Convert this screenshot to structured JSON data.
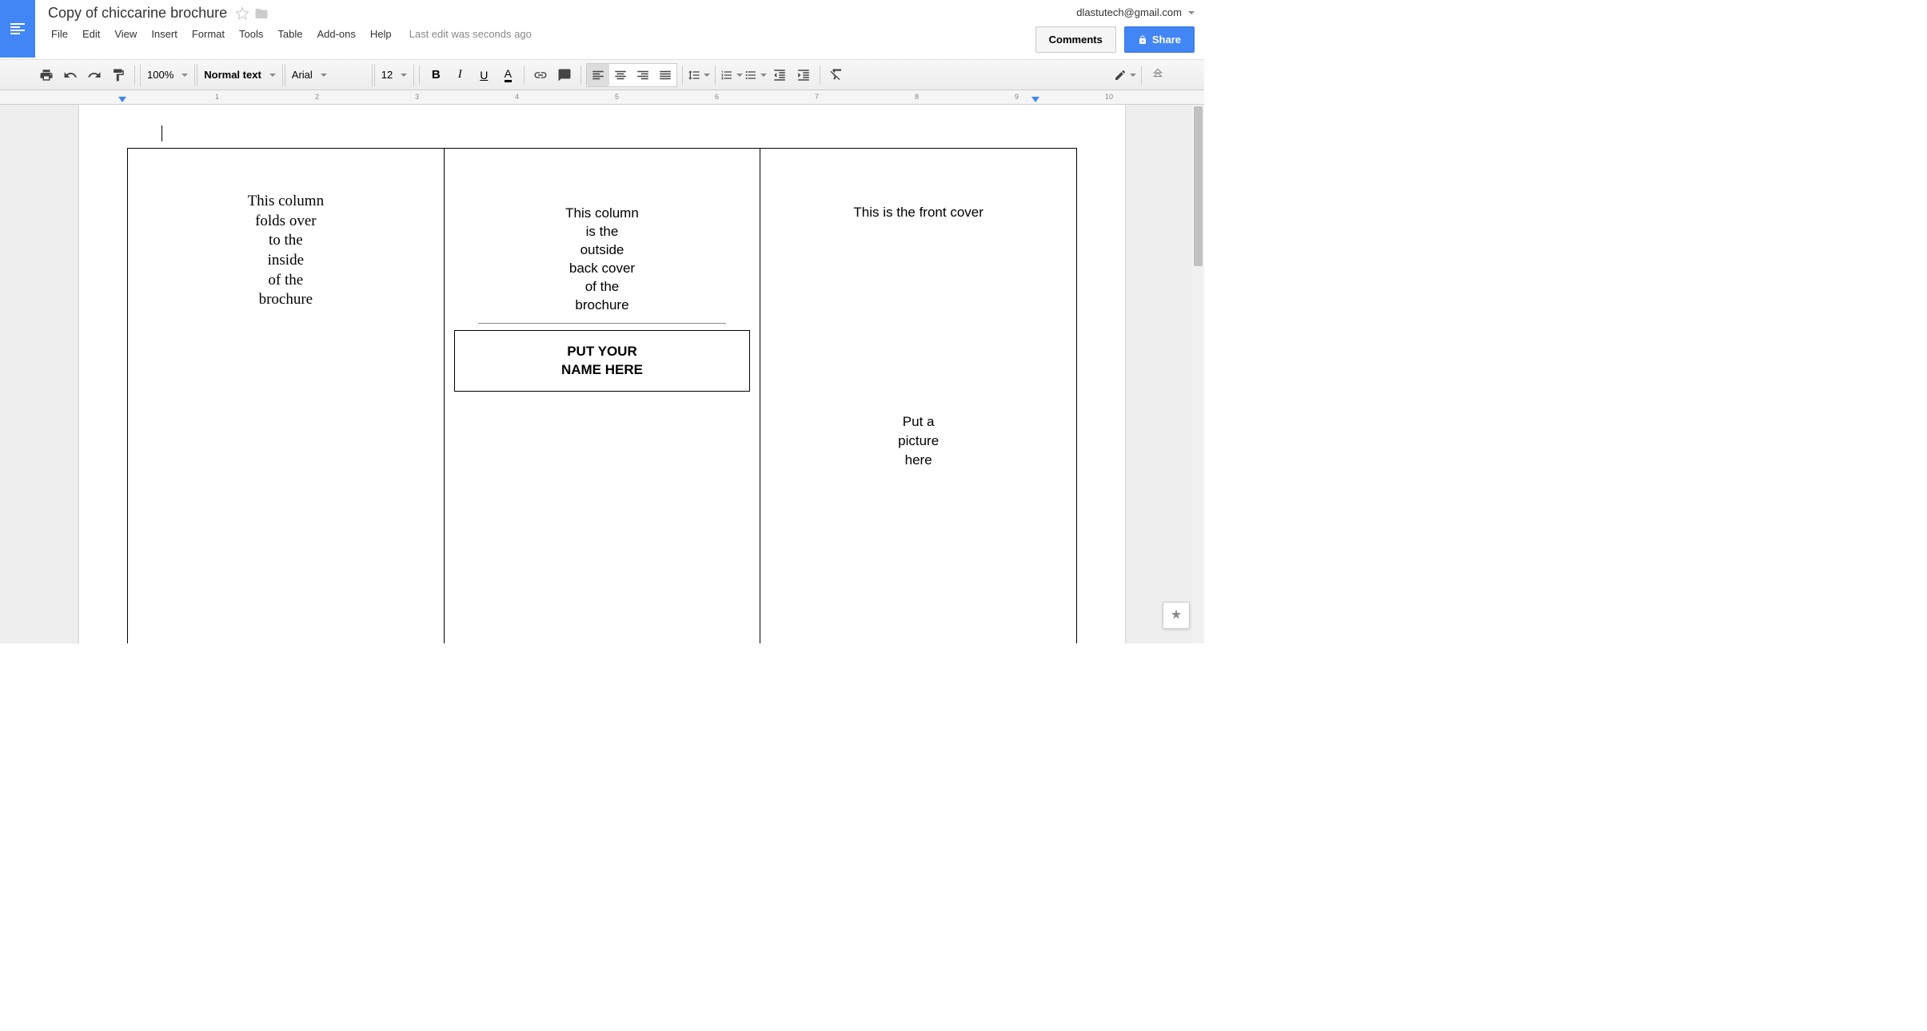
{
  "header": {
    "doc_title": "Copy of chiccarine brochure",
    "user_email": "dlastutech@gmail.com",
    "comments_label": "Comments",
    "share_label": "Share",
    "last_edit": "Last edit was seconds ago"
  },
  "menu": {
    "file": "File",
    "edit": "Edit",
    "view": "View",
    "insert": "Insert",
    "format": "Format",
    "tools": "Tools",
    "table": "Table",
    "addons": "Add-ons",
    "help": "Help"
  },
  "toolbar": {
    "zoom": "100%",
    "style": "Normal text",
    "font": "Arial",
    "size": "12"
  },
  "ruler": {
    "ticks": [
      "1",
      "2",
      "3",
      "4",
      "5",
      "6",
      "7",
      "8",
      "9",
      "10"
    ]
  },
  "document": {
    "col1": {
      "l1": "This column",
      "l2": "folds over",
      "l3": "to the",
      "l4": "inside",
      "l5": "of the",
      "l6": "brochure"
    },
    "col2": {
      "l1": "This column",
      "l2": "is the",
      "l3": "outside",
      "l4": "back cover",
      "l5": "of the",
      "l6": "brochure",
      "name_l1": "PUT YOUR",
      "name_l2": "NAME HERE"
    },
    "col3": {
      "title": "This is the front cover",
      "pic_l1": "Put a",
      "pic_l2": "picture",
      "pic_l3": "here"
    }
  }
}
